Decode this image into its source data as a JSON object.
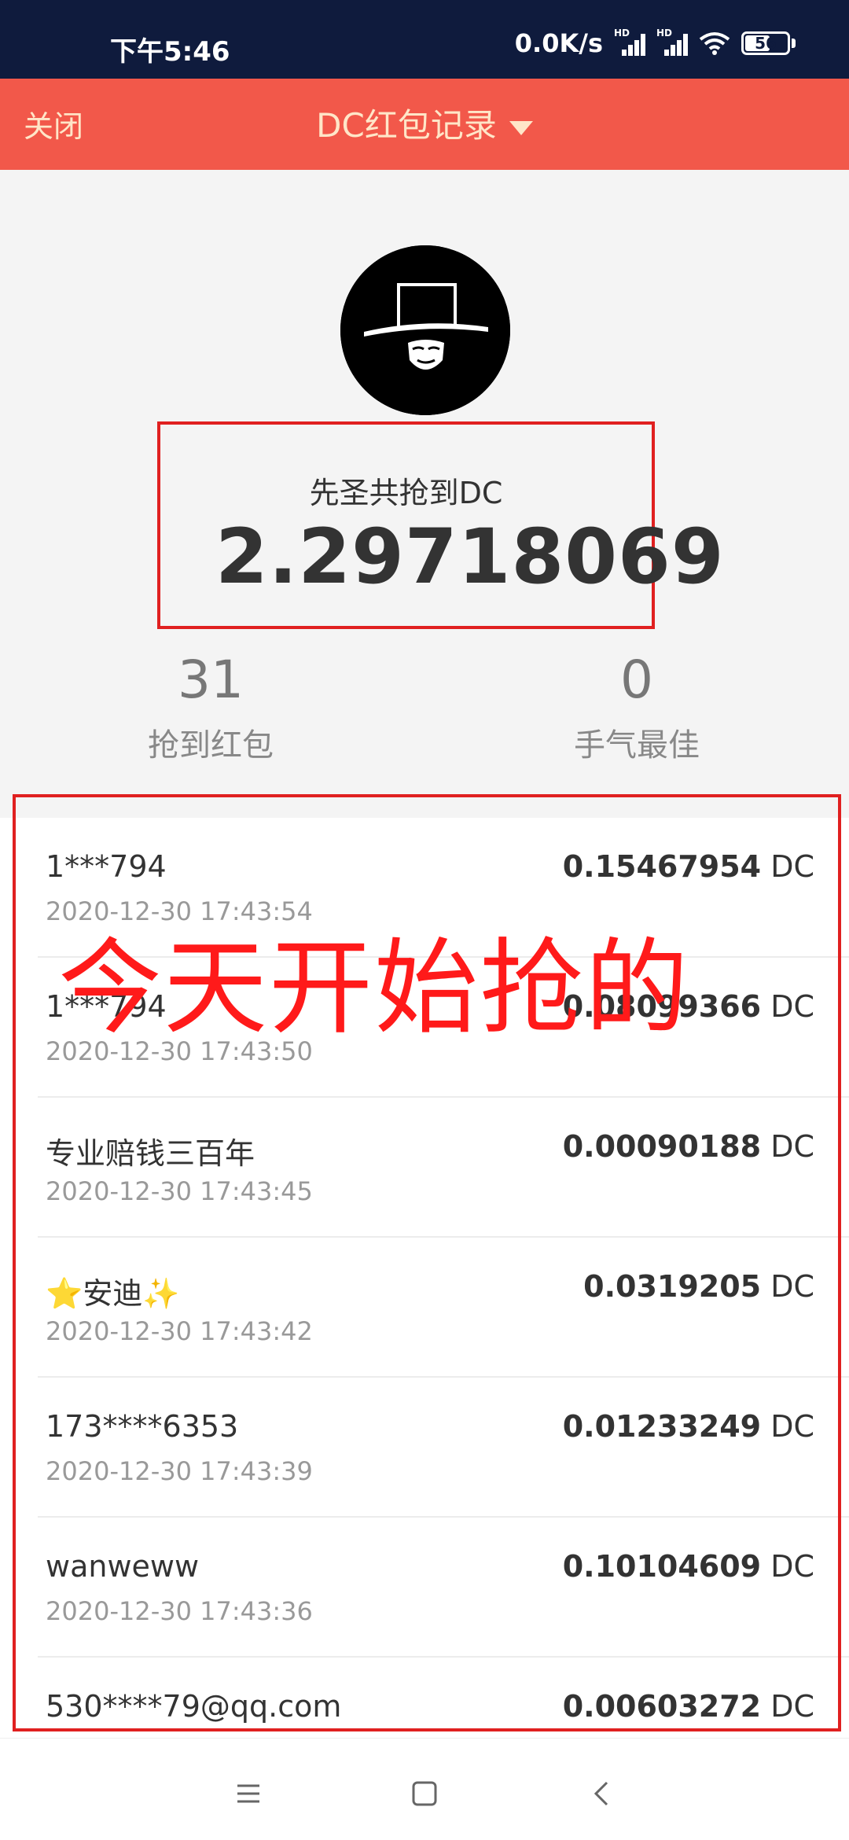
{
  "status_bar": {
    "time": "下午5:46",
    "speed": "0.0K/s",
    "hd_label": "HD",
    "battery": "56"
  },
  "header": {
    "close_label": "关闭",
    "title": "DC红包记录"
  },
  "summary": {
    "label": "先圣共抢到DC",
    "amount": "2.29718069"
  },
  "stats": {
    "grabbed_count": "31",
    "grabbed_label": "抢到红包",
    "best_count": "0",
    "best_label": "手气最佳"
  },
  "records": [
    {
      "name": "1***794",
      "time": "2020-12-30 17:43:54",
      "amount": "0.15467954",
      "unit": " DC"
    },
    {
      "name": "1***794",
      "time": "2020-12-30 17:43:50",
      "amount": "0.08099366",
      "unit": " DC"
    },
    {
      "name": "专业赔钱三百年",
      "time": "2020-12-30 17:43:45",
      "amount": "0.00090188",
      "unit": " DC"
    },
    {
      "name": "⭐安迪✨",
      "time": "2020-12-30 17:43:42",
      "amount": "0.0319205",
      "unit": " DC"
    },
    {
      "name": "173****6353",
      "time": "2020-12-30 17:43:39",
      "amount": "0.01233249",
      "unit": " DC"
    },
    {
      "name": "wanweww",
      "time": "2020-12-30 17:43:36",
      "amount": "0.10104609",
      "unit": " DC"
    },
    {
      "name": "530****79@qq.com",
      "time": "",
      "amount": "0.00603272",
      "unit": " DC"
    }
  ],
  "annotation": {
    "text": "今天开始抢的"
  },
  "colors": {
    "header": "#f2584a",
    "annotation": "#ff1a1a",
    "status_bar": "#0f1b3d"
  }
}
